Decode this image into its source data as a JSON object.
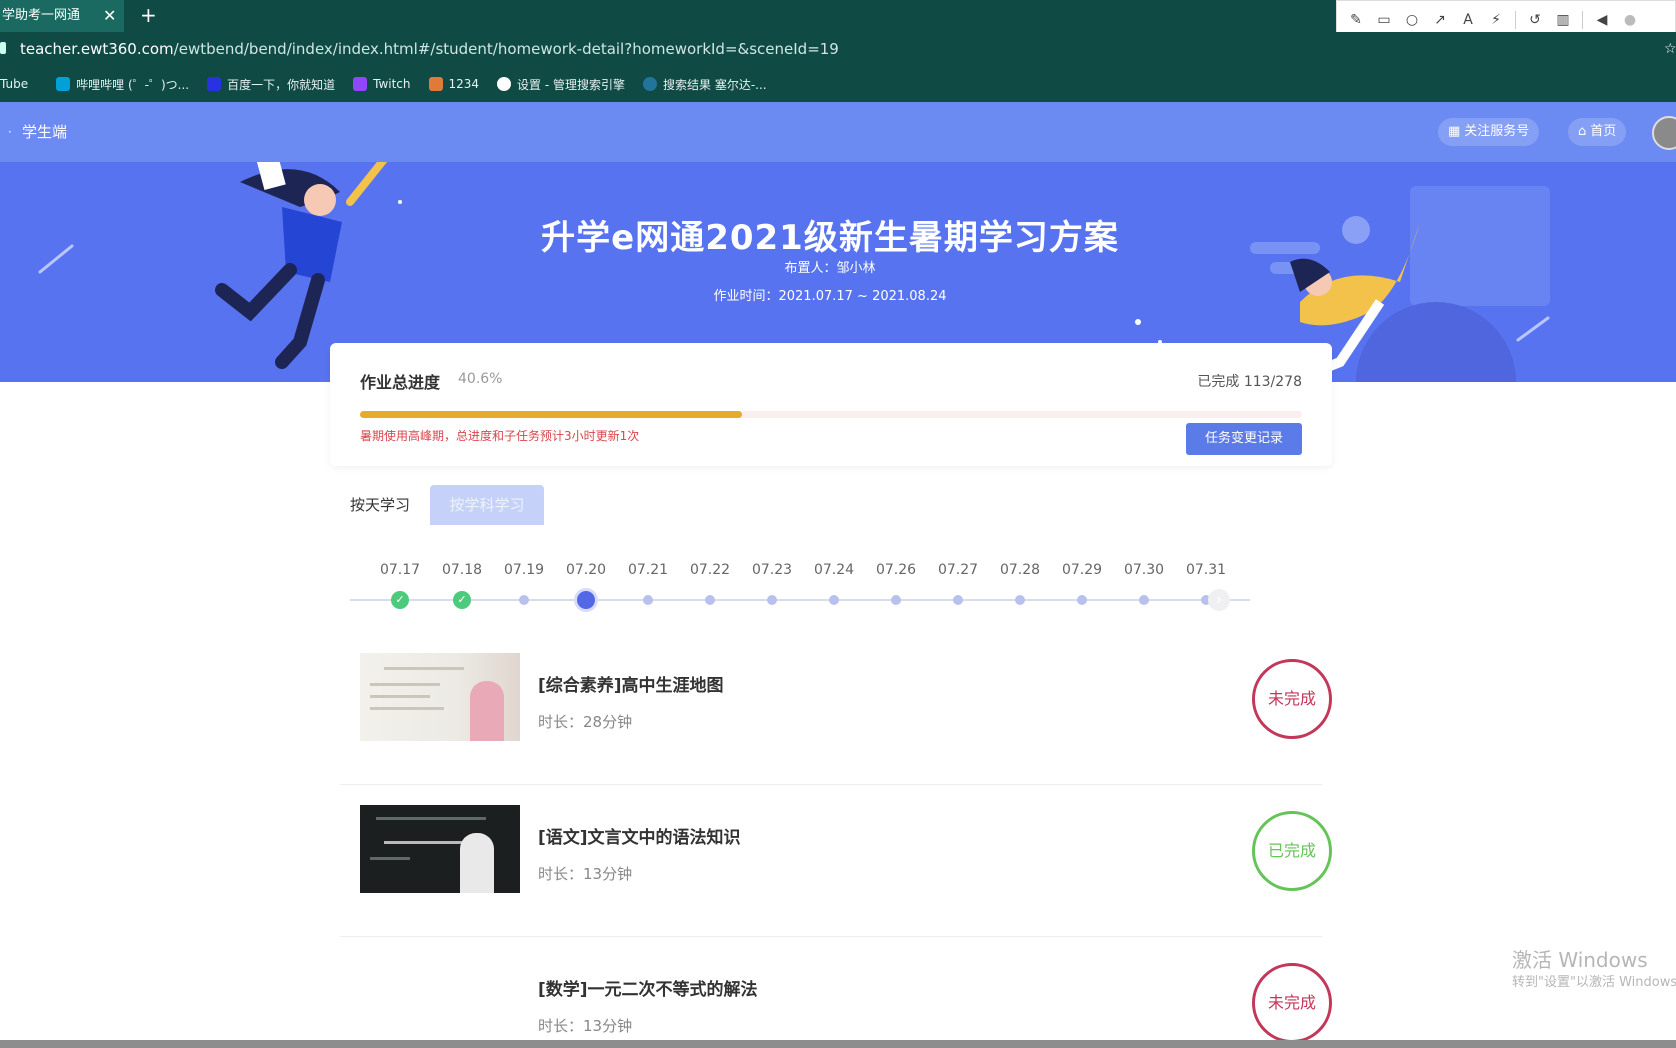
{
  "browser": {
    "tab_title": "学助考一网通",
    "tab_close": "✕",
    "new_tab": "+",
    "url_host": "teacher.ewt360.com",
    "url_path": "/ewtbend/bend/index/index.html#/student/homework-detail?homeworkId=&sceneId=19",
    "bookmarks": [
      {
        "label": "Tube",
        "color": "#cc0000"
      },
      {
        "label": "哔哩哔哩 (゜-゜)つ...",
        "color": "#00a1d6"
      },
      {
        "label": "百度一下，你就知道",
        "color": "#2932e1"
      },
      {
        "label": "Twitch",
        "color": "#9146ff"
      },
      {
        "label": "1234",
        "color": "#e07a3a"
      },
      {
        "label": "设置 - 管理搜索引擎",
        "color": "#ffffff"
      },
      {
        "label": "搜索结果 塞尔达-...",
        "color": "#21759b"
      }
    ]
  },
  "annotation_tools": [
    "pencil-icon",
    "rectangle-icon",
    "circle-icon",
    "arrow-icon",
    "text-icon",
    "magic-wand-icon",
    "undo-icon",
    "trash-icon",
    "speaker-icon",
    "microphone-icon"
  ],
  "header": {
    "section": "学生端",
    "follow_label": "关注服务号",
    "home_label": "首页"
  },
  "banner": {
    "title": "升学e网通2021级新生暑期学习方案",
    "assigner": "布置人：邹小林",
    "period": "作业时间：2021.07.17 ~ 2021.08.24"
  },
  "progress": {
    "title": "作业总进度",
    "percent_text": "40.6%",
    "percent_value": 40.6,
    "done_label": "已完成",
    "done_count": "113/278",
    "warning": "暑期使用高峰期，总进度和子任务预计3小时更新1次",
    "record_button": "任务变更记录"
  },
  "tabs": {
    "by_day": "按天学习",
    "by_subject": "按学科学习"
  },
  "timeline": {
    "days": [
      {
        "date": "07.17",
        "state": "done"
      },
      {
        "date": "07.18",
        "state": "done"
      },
      {
        "date": "07.19",
        "state": "pending"
      },
      {
        "date": "07.20",
        "state": "current"
      },
      {
        "date": "07.21",
        "state": "pending"
      },
      {
        "date": "07.22",
        "state": "pending"
      },
      {
        "date": "07.23",
        "state": "pending"
      },
      {
        "date": "07.24",
        "state": "pending"
      },
      {
        "date": "07.26",
        "state": "pending"
      },
      {
        "date": "07.27",
        "state": "pending"
      },
      {
        "date": "07.28",
        "state": "pending"
      },
      {
        "date": "07.29",
        "state": "pending"
      },
      {
        "date": "07.30",
        "state": "pending"
      },
      {
        "date": "07.31",
        "state": "pending"
      }
    ],
    "check": "✓",
    "next": "›"
  },
  "tasks": [
    {
      "title": "[综合素养]高中生涯地图",
      "duration": "时长：28分钟",
      "status": "未完成",
      "state": "todo",
      "thumb": "light"
    },
    {
      "title": "[语文]文言文中的语法知识",
      "duration": "时长：13分钟",
      "status": "已完成",
      "state": "ok",
      "thumb": "dark"
    },
    {
      "title": "[数学]一元二次不等式的解法",
      "duration": "时长：13分钟",
      "status": "未完成",
      "state": "todo",
      "thumb": "none"
    }
  ],
  "watermark": {
    "line1": "激活 Windows",
    "line2": "转到\"设置\"以激活 Windows。"
  },
  "colors": {
    "header": "#6b8af2",
    "banner": "#5873ef",
    "progress_fill": "#e8aa2b",
    "button": "#5b7be8",
    "todo": "#c2375a",
    "done": "#64c457"
  }
}
